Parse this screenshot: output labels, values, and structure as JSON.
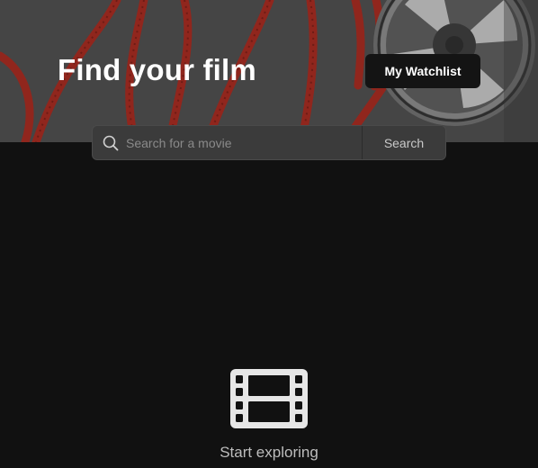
{
  "hero": {
    "title": "Find your film",
    "watchlist_button": "My Watchlist",
    "background_image": "film-reel-image"
  },
  "search": {
    "placeholder": "Search for a movie",
    "value": "",
    "button_label": "Search",
    "icon": "search-icon"
  },
  "empty_state": {
    "icon": "film-icon",
    "label": "Start exploring"
  },
  "colors": {
    "page_background": "#111111",
    "hero_tint": "#4a4a4a",
    "button_background": "#141414",
    "search_background": "#3b3b3b",
    "film_red": "#a8271c",
    "muted_text": "#bdbdbd"
  }
}
